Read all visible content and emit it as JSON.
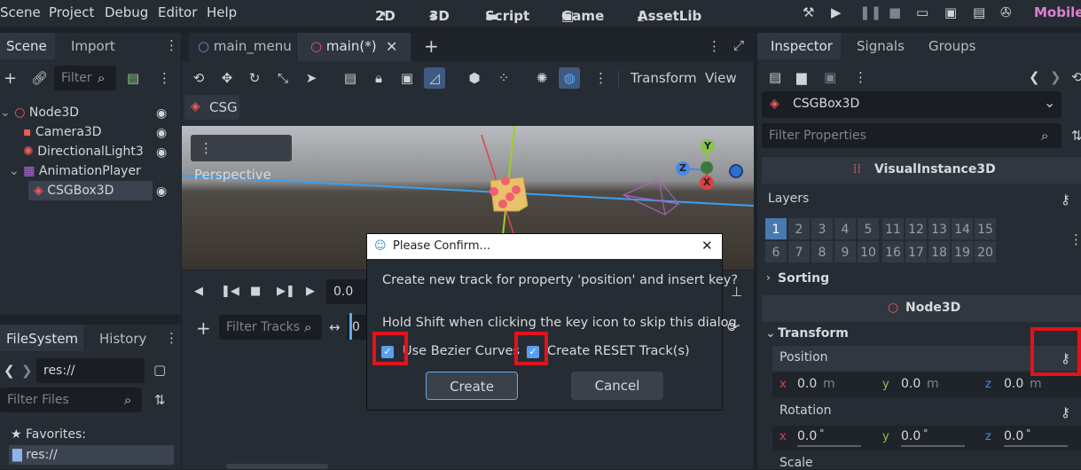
{
  "menubar": {
    "items": [
      "Scene",
      "Project",
      "Debug",
      "Editor",
      "Help"
    ]
  },
  "workspaces": [
    "2D",
    "3D",
    "Script",
    "Game",
    "AssetLib"
  ],
  "workspace_icons": {
    "2D": "↗",
    "3D": "⌖",
    "Script": "▬",
    "Game": "▣",
    "AssetLib": "⤓"
  },
  "renderer": "Mobile",
  "scene_dock": {
    "tabs": [
      "Scene",
      "Import"
    ],
    "filter_placeholder": "Filter",
    "tree": [
      {
        "label": "Node3D",
        "icon": "○",
        "color": "#f05a5a"
      },
      {
        "label": "Camera3D",
        "icon": "▪",
        "color": "#f05a5a"
      },
      {
        "label": "DirectionalLight3",
        "icon": "✺",
        "color": "#f05a5a"
      },
      {
        "label": "AnimationPlayer",
        "icon": "▦",
        "color": "#b06ce0"
      },
      {
        "label": "CSGBox3D",
        "icon": "◈",
        "color": "#f05a5a"
      }
    ]
  },
  "filesystem_dock": {
    "tabs": [
      "FileSystem",
      "History"
    ],
    "path": "res://",
    "filter_placeholder": "Filter Files",
    "favorites_label": "Favorites:",
    "res_item": "res://"
  },
  "editor_tabs": [
    "main_menu",
    "main(*)"
  ],
  "toolbar": {
    "transform_label": "Transform",
    "view_label": "View",
    "csg_label": "CSG"
  },
  "viewport": {
    "perspective_label": "Perspective",
    "gizmo": {
      "x": "X",
      "y": "Y",
      "z": "Z"
    }
  },
  "animation": {
    "time": "0.0",
    "filter_placeholder": "Filter Tracks",
    "zero": "0"
  },
  "dialog": {
    "title": "Please Confirm...",
    "message": "Create new track for property 'position' and insert key?",
    "hint": "Hold Shift when clicking the key icon to skip this dialog.",
    "check1": "Use Bezier Curves",
    "check2": "Create RESET Track(s)",
    "create": "Create",
    "cancel": "Cancel"
  },
  "inspector": {
    "tabs": [
      "Inspector",
      "Signals",
      "Groups"
    ],
    "node": "CSGBox3D",
    "filter_placeholder": "Filter Properties",
    "section_visual": "VisualInstance3D",
    "layers_label": "Layers",
    "layers_row1": [
      "1",
      "2",
      "3",
      "4",
      "5",
      "11",
      "12",
      "13",
      "14",
      "15"
    ],
    "layers_row2": [
      "6",
      "7",
      "8",
      "9",
      "10",
      "16",
      "17",
      "18",
      "19",
      "20"
    ],
    "sorting_label": "Sorting",
    "section_node": "Node3D",
    "transform_label": "Transform",
    "position_label": "Position",
    "position": {
      "x": "0.0",
      "y": "0.0",
      "z": "0.0",
      "unit": "m"
    },
    "rotation_label": "Rotation",
    "rotation": {
      "x": "0.0",
      "y": "0.0",
      "z": "0.0",
      "unit": "°"
    },
    "scale_label": "Scale"
  },
  "colors": {
    "accent": "#5fa8f0",
    "highlight": "#e0131b",
    "renderer": "#e07fd2"
  }
}
